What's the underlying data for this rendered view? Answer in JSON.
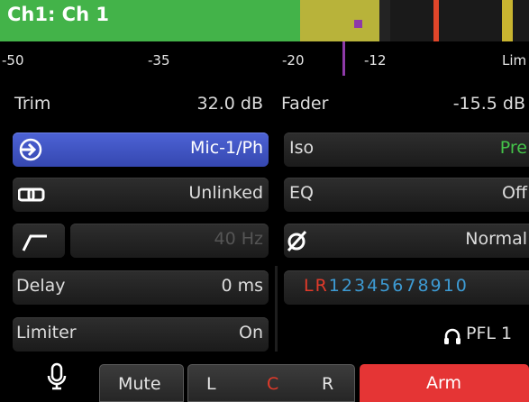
{
  "header": {
    "channel_title": "Ch1: Ch 1",
    "meter_colors": {
      "signal": "#43b349",
      "peak": "#b8b33a",
      "over": "#e0462a",
      "marker": "#8e3aa8"
    }
  },
  "scale": {
    "labels": [
      "-50",
      "-35",
      "-20",
      "-12",
      "Lim"
    ]
  },
  "left": {
    "trim_label": "Trim",
    "trim_value": "32.0 dB",
    "input_icon": "input-arrow-icon",
    "input_value": "Mic-1/Ph",
    "link_icon": "link-icon",
    "link_value": "Unlinked",
    "hpf_icon": "high-pass-filter-icon",
    "hpf_value": "40 Hz",
    "delay_label": "Delay",
    "delay_value": "0 ms",
    "limiter_label": "Limiter",
    "limiter_value": "On"
  },
  "right": {
    "fader_label": "Fader",
    "fader_value": "-15.5 dB",
    "iso_label": "Iso",
    "iso_value": "Pre",
    "eq_label": "EQ",
    "eq_value": "Off",
    "phase_icon": "phase-invert-icon",
    "phase_value": "Normal",
    "routing": [
      "L",
      "R",
      "1",
      "2",
      "3",
      "4",
      "5",
      "6",
      "7",
      "8",
      "9",
      "10"
    ],
    "pfl_icon": "headphones-icon",
    "pfl_value": "PFL 1"
  },
  "footer": {
    "mic_icon": "microphone-icon",
    "mute_label": "Mute",
    "pan_left": "L",
    "pan_center": "C",
    "pan_right": "R",
    "arm_label": "Arm"
  }
}
